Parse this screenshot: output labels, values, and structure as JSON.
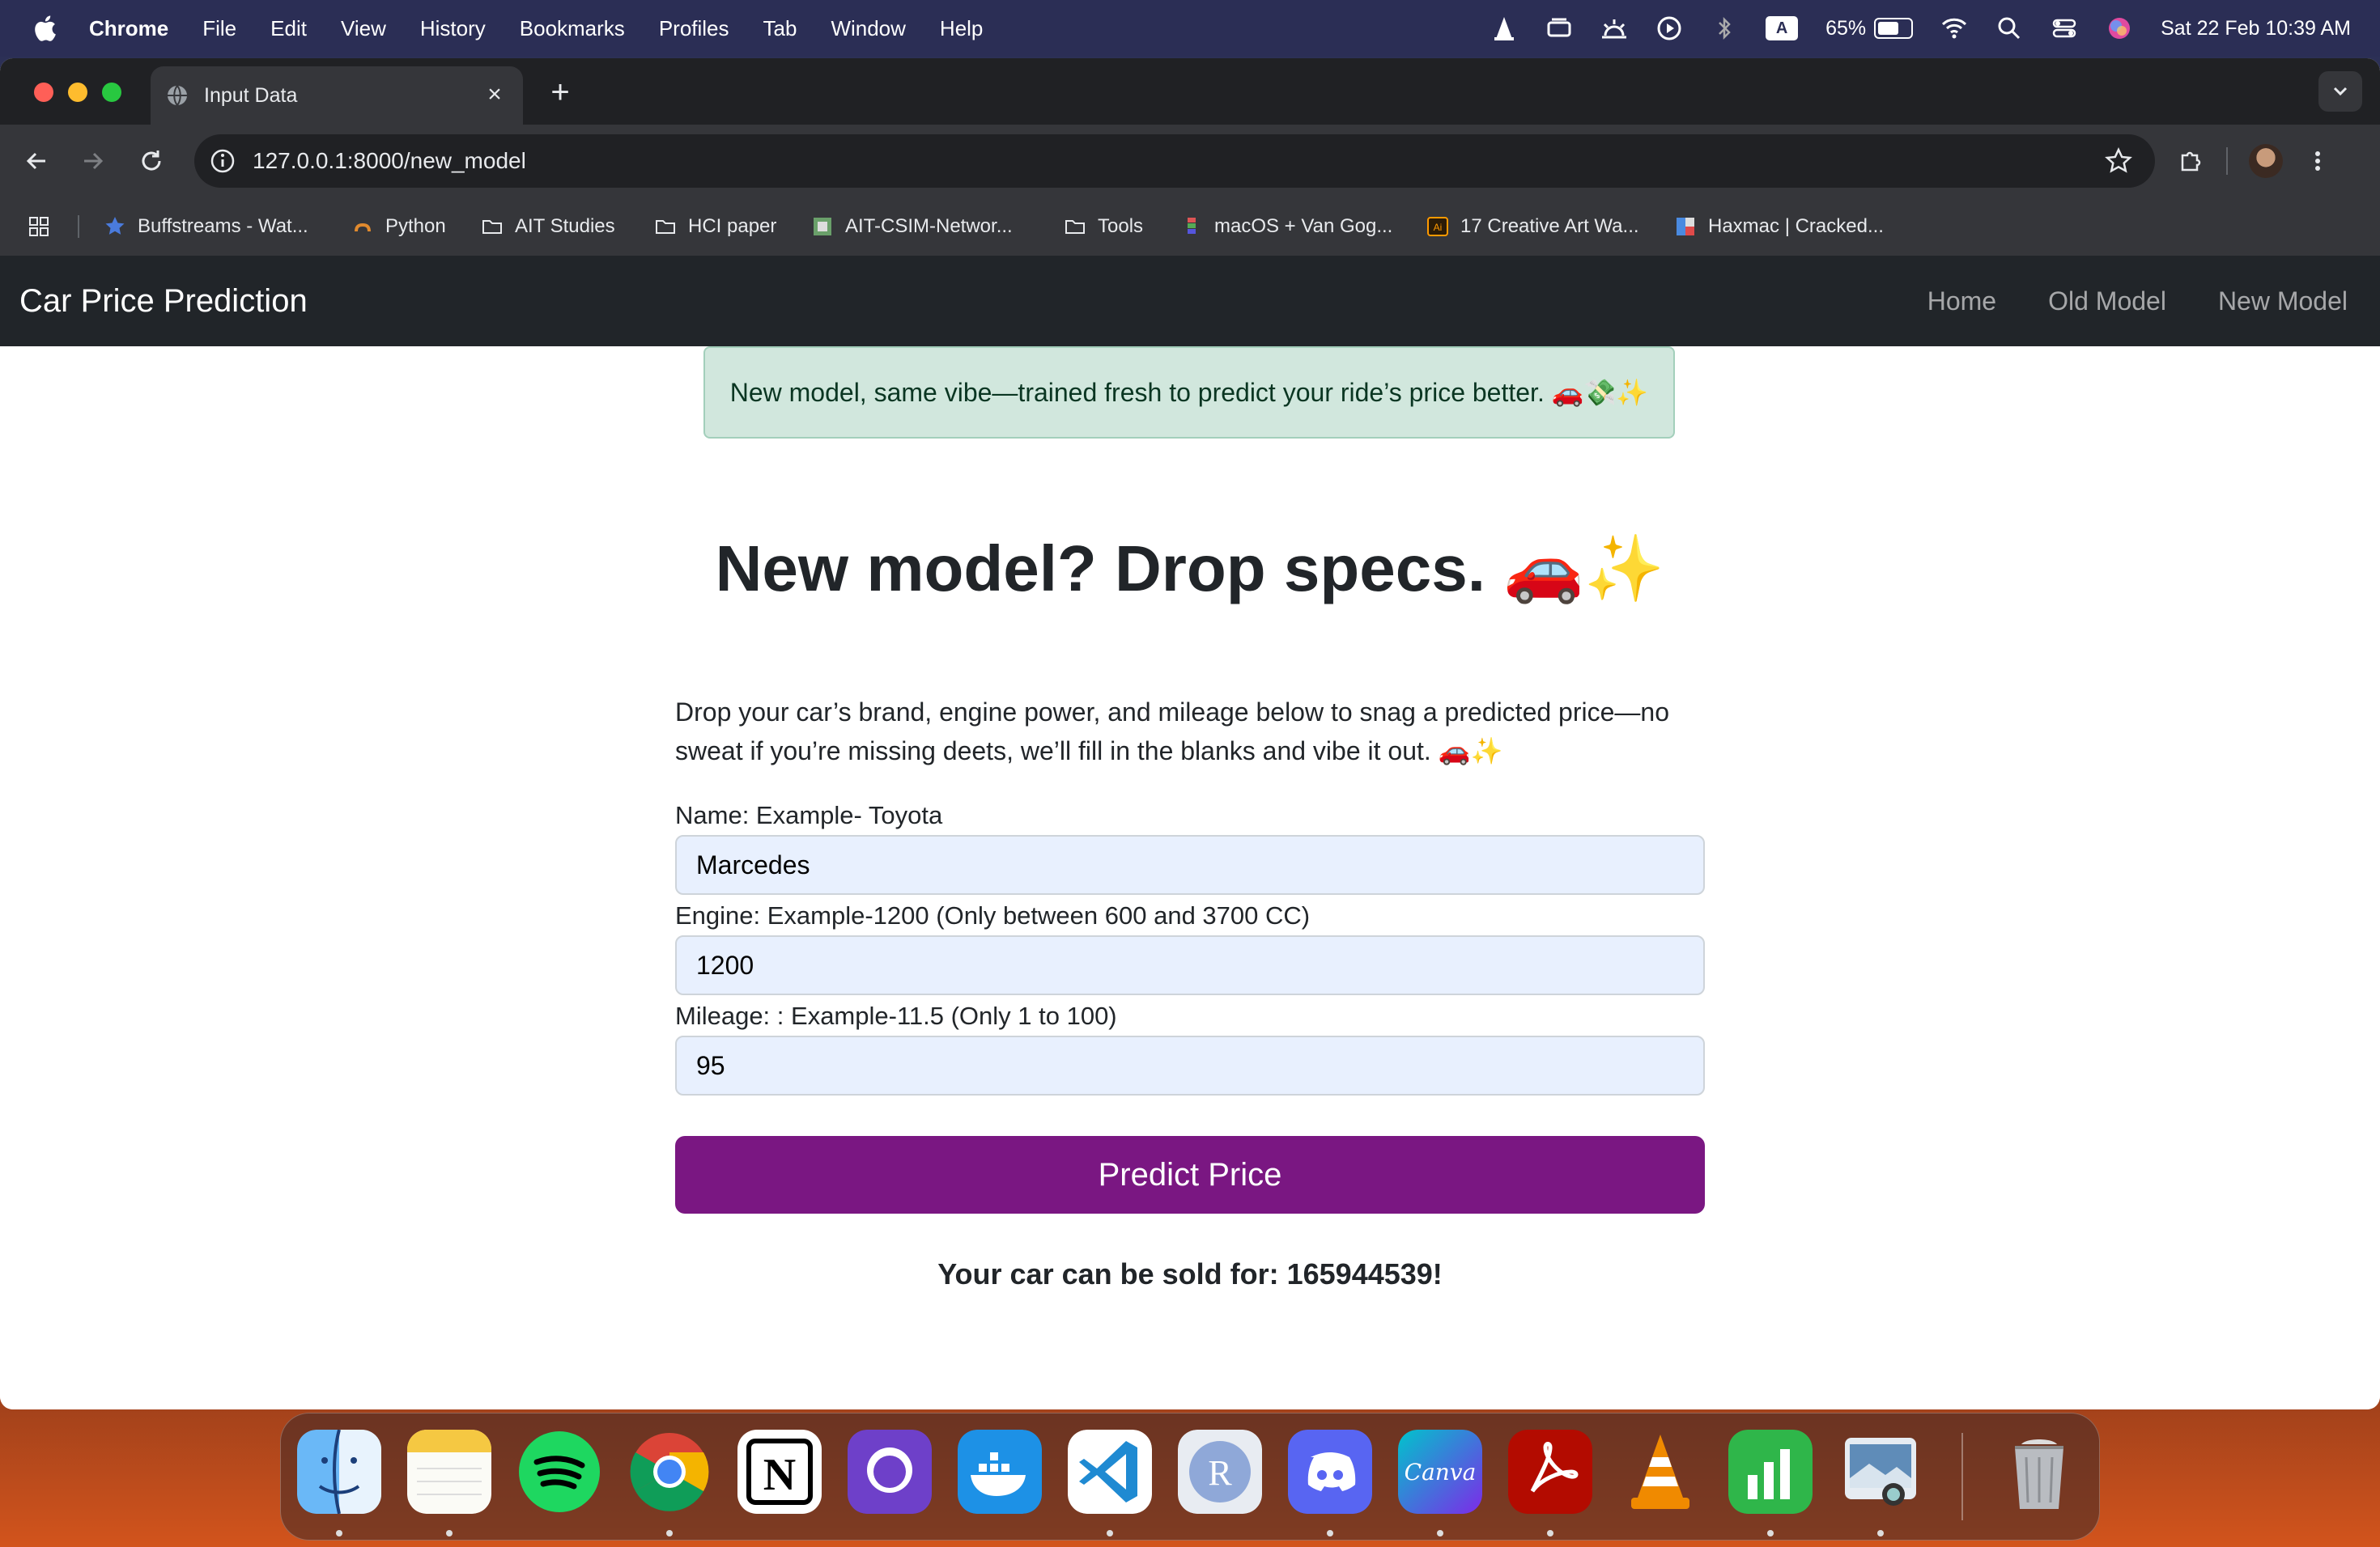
{
  "menubar": {
    "app": "Chrome",
    "items": [
      "File",
      "Edit",
      "View",
      "History",
      "Bookmarks",
      "Profiles",
      "Tab",
      "Window",
      "Help"
    ],
    "battery_percent": "65%",
    "battery_level": 0.65,
    "datetime": "Sat 22 Feb  10:39 AM",
    "input_badge": "A"
  },
  "browser": {
    "tab_title": "Input Data",
    "url": "127.0.0.1:8000/new_model",
    "bookmarks": [
      {
        "label": "Buffstreams - Wat...",
        "icon": "star-icon"
      },
      {
        "label": "Python",
        "icon": "python-icon"
      },
      {
        "label": "AIT Studies",
        "icon": "folder-icon"
      },
      {
        "label": "HCI paper",
        "icon": "folder-icon"
      },
      {
        "label": "AIT-CSIM-Networ...",
        "icon": "site-icon"
      },
      {
        "label": "Tools",
        "icon": "folder-icon"
      },
      {
        "label": "macOS + Van Gog...",
        "icon": "site-icon"
      },
      {
        "label": "17 Creative Art Wa...",
        "icon": "illustrator-icon"
      },
      {
        "label": "Haxmac | Cracked...",
        "icon": "site-icon"
      }
    ]
  },
  "navbar": {
    "brand": "Car Price Prediction",
    "links": [
      "Home",
      "Old Model",
      "New Model"
    ]
  },
  "alert": "New model, same vibe—trained fresh to predict your ride’s price better. 🚗💸✨",
  "form": {
    "heading": "New model? Drop specs. 🚗✨",
    "description": "Drop your car’s brand, engine power, and mileage below to snag a predicted price—no sweat if you’re missing deets, we’ll fill in the blanks and vibe it out. 🚗✨",
    "name_label": "Name: Example- Toyota",
    "name_value": "Marcedes",
    "engine_label": "Engine: Example-1200 (Only between 600 and 3700 CC)",
    "engine_value": "1200",
    "mileage_label": "Mileage: : Example-11.5 (Only 1 to 100)",
    "mileage_value": "95",
    "submit_label": "Predict Price",
    "result": "Your car can be sold for: 165944539!"
  },
  "colors": {
    "navbar_bg": "#212529",
    "button_purple": "#7a1782",
    "alert_bg": "#d1e7dd",
    "input_bg": "#e8f0fe"
  },
  "dock": [
    "finder-icon",
    "notes-icon",
    "spotify-icon",
    "chrome-icon",
    "notion-icon",
    "github-desktop-icon",
    "docker-icon",
    "vscode-icon",
    "r-icon",
    "discord-icon",
    "canva-icon",
    "acrobat-icon",
    "vlc-icon",
    "numbers-icon",
    "preview-icon",
    "trash-icon"
  ]
}
